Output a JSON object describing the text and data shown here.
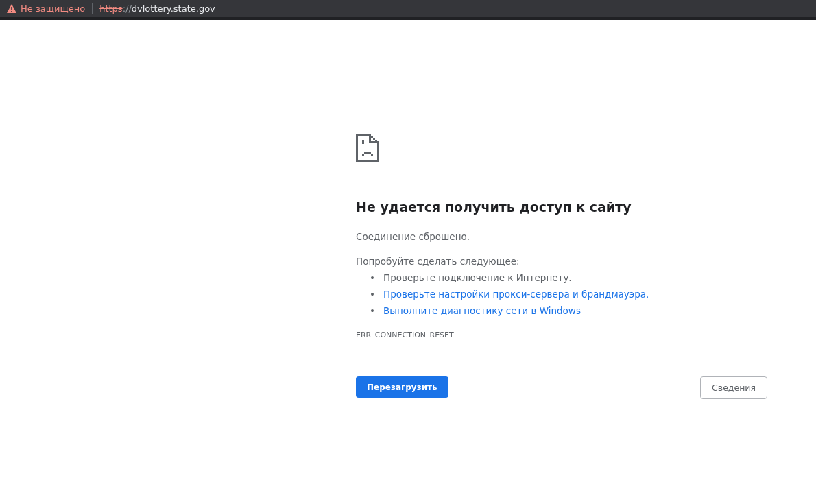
{
  "address_bar": {
    "security_label": "Не защищено",
    "url_scheme": "https",
    "url_separator": "://",
    "url_host": "dvlottery.state.gov"
  },
  "error": {
    "title": "Не удается получить доступ к сайту",
    "message": "Соединение сброшено.",
    "suggestions_heading": "Попробуйте сделать следующее:",
    "suggestions": [
      {
        "kind": "text",
        "bullet": "•",
        "text": "Проверьте подключение к Интернету."
      },
      {
        "kind": "link",
        "bullet": "•",
        "text": "Проверьте настройки прокси-сервера и брандмауэра."
      },
      {
        "kind": "link",
        "bullet": "•",
        "text": "Выполните диагностику сети в Windows"
      }
    ],
    "code": "ERR_CONNECTION_RESET"
  },
  "buttons": {
    "reload": "Перезагрузить",
    "details": "Сведения"
  }
}
